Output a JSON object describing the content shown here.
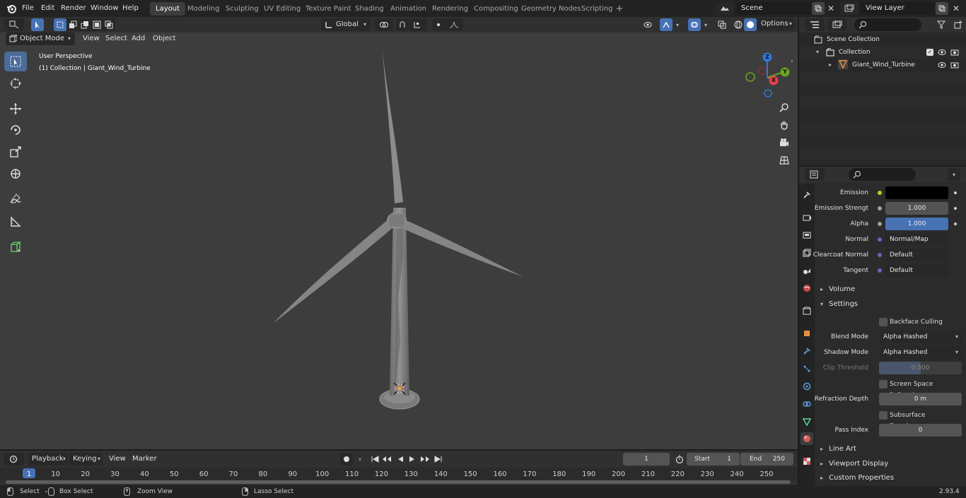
{
  "menu": {
    "items": [
      "File",
      "Edit",
      "Render",
      "Window",
      "Help"
    ]
  },
  "workspaces": [
    "Layout",
    "Modeling",
    "Sculpting",
    "UV Editing",
    "Texture Paint",
    "Shading",
    "Animation",
    "Rendering",
    "Compositing",
    "Geometry Nodes",
    "Scripting"
  ],
  "scene": {
    "name": "Scene",
    "view_layer": "View Layer"
  },
  "viewport": {
    "mode": "Object Mode",
    "view": "View",
    "select": "Select",
    "add": "Add",
    "object": "Object",
    "orientation": "Global",
    "options": "Options",
    "perspective": "User Perspective",
    "collection_info": "(1) Collection | Giant_Wind_Turbine",
    "gizmo": {
      "z": "Z",
      "y": "Y",
      "x": "X"
    }
  },
  "outliner": {
    "scene_collection": "Scene Collection",
    "collection": "Collection",
    "object": "Giant_Wind_Turbine"
  },
  "properties": {
    "rows": [
      {
        "label": "Emission",
        "value": "",
        "kind": "color"
      },
      {
        "label": "Emission Strengt",
        "value": "1.000",
        "kind": "num"
      },
      {
        "label": "Alpha",
        "value": "1.000",
        "kind": "blue"
      },
      {
        "label": "Normal",
        "value": "Normal/Map",
        "kind": "link"
      },
      {
        "label": "Clearcoat Normal",
        "value": "Default",
        "kind": "link"
      },
      {
        "label": "Tangent",
        "value": "Default",
        "kind": "link"
      }
    ],
    "volume": "Volume",
    "settings": "Settings",
    "backface": "Backface Culling",
    "blend_label": "Blend Mode",
    "blend_value": "Alpha Hashed",
    "shadow_label": "Shadow Mode",
    "shadow_value": "Alpha Hashed",
    "clip_label": "Clip Threshold",
    "clip_value": "0.500",
    "ssr": "Screen Space Refraction",
    "refr_label": "Refraction Depth",
    "refr_value": "0 m",
    "sss": "Subsurface Translucency",
    "pass_label": "Pass Index",
    "pass_value": "0",
    "line_art": "Line Art",
    "viewport_display": "Viewport Display",
    "custom_props": "Custom Properties"
  },
  "timeline": {
    "playback": "Playback",
    "keying": "Keying",
    "view": "View",
    "marker": "Marker",
    "current_frame": "1",
    "start_label": "Start",
    "start": "1",
    "end_label": "End",
    "end": "250",
    "ticks": [
      "1",
      "10",
      "20",
      "30",
      "40",
      "50",
      "60",
      "70",
      "80",
      "90",
      "100",
      "110",
      "120",
      "130",
      "140",
      "150",
      "160",
      "170",
      "180",
      "190",
      "200",
      "210",
      "220",
      "230",
      "240",
      "250"
    ]
  },
  "status": {
    "select": "Select",
    "box_select": "Box Select",
    "zoom_view": "Zoom View",
    "lasso_select": "Lasso Select",
    "version": "2.93.4"
  },
  "colors": {
    "accent": "#4772b3",
    "active_tool": "#4b6b99",
    "viewport_bg": "#3d3d3d",
    "gizmo_x": "#e5404e",
    "gizmo_y": "#6aa522",
    "gizmo_z": "#2e76d6"
  }
}
